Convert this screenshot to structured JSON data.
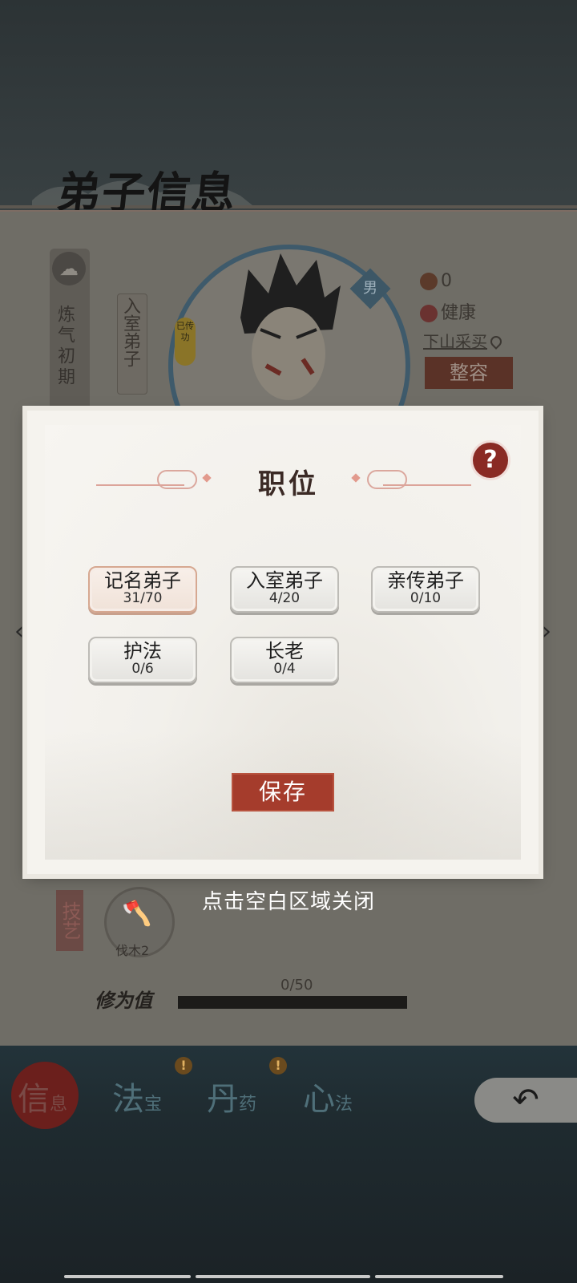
{
  "screen": {
    "title": "弟子信息",
    "rank": "炼气初期",
    "current_role": "入室弟子",
    "portrait_badge": "已传功",
    "gender": "男",
    "stats": {
      "reputation": "0",
      "health": "健康"
    },
    "shop_link": "下山采买",
    "makeover_button": "整容",
    "skills": {
      "section_label": "技艺",
      "skill_name": "伐木2"
    },
    "cultivation": {
      "label": "修为值",
      "value": "0/50",
      "progress": 0
    }
  },
  "dialog": {
    "title": "职位",
    "help_label": "?",
    "roles": [
      {
        "name": "记名弟子",
        "count": "31/70",
        "selected": true
      },
      {
        "name": "入室弟子",
        "count": "4/20",
        "selected": false
      },
      {
        "name": "亲传弟子",
        "count": "0/10",
        "selected": false
      },
      {
        "name": "护法",
        "count": "0/6",
        "selected": false
      },
      {
        "name": "长老",
        "count": "0/4",
        "selected": false
      }
    ],
    "save_label": "保存",
    "close_hint": "点击空白区域关闭"
  },
  "bottom_nav": {
    "items": [
      {
        "main": "信",
        "sub": "息",
        "active": true,
        "alert": false
      },
      {
        "main": "法",
        "sub": "宝",
        "active": false,
        "alert": true
      },
      {
        "main": "丹",
        "sub": "药",
        "active": false,
        "alert": true
      },
      {
        "main": "心",
        "sub": "法",
        "active": false,
        "alert": false
      }
    ],
    "alert_symbol": "!",
    "back_icon": "back-arrow-icon"
  },
  "colors": {
    "accent_red": "#a53c2c",
    "selected_border": "#d6a891",
    "dialog_bg": "#f5f3ee"
  }
}
